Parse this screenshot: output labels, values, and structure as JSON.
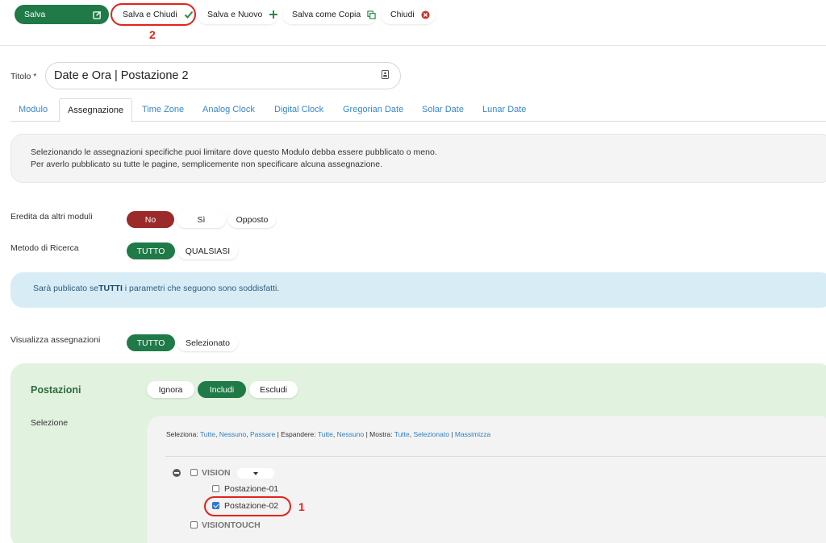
{
  "toolbar": {
    "save_label": "Salva",
    "save_close_label": "Salva e Chiudi",
    "save_new_label": "Salva e Nuovo",
    "save_copy_label": "Salva come Copia",
    "close_label": "Chiudi"
  },
  "annotations": {
    "one": "1",
    "two": "2"
  },
  "title_field": {
    "label": "Titolo *",
    "value": "Date e Ora | Postazione 2"
  },
  "tabs": [
    "Modulo",
    "Assegnazione",
    "Time Zone",
    "Analog Clock",
    "Digital Clock",
    "Gregorian Date",
    "Solar Date",
    "Lunar Date"
  ],
  "active_tab": "Assegnazione",
  "info": {
    "line1": "Selezionando le assegnazioni specifiche puoi limitare dove questo Modulo debba essere pubblicato o meno.",
    "line2": "Per averlo pubblicato su tutte le pagine, semplicemente non specificare alcuna assegnazione."
  },
  "inherit": {
    "label": "Eredita da altri moduli",
    "options": [
      "No",
      "Sì",
      "Opposto"
    ],
    "selected": "No"
  },
  "method": {
    "label": "Metodo di Ricerca",
    "options": [
      "TUTTO",
      "QUALSIASI"
    ],
    "selected": "TUTTO"
  },
  "notice": {
    "prefix": "Sarà publicato se",
    "strong": "TUTTI",
    "suffix": " i parametri che seguono sono soddisfatti."
  },
  "show_assign": {
    "label": "Visualizza assegnazioni",
    "options": [
      "TUTTO",
      "Selezionato"
    ],
    "selected": "TUTTO"
  },
  "postazioni": {
    "title": "Postazioni",
    "options": [
      "Ignora",
      "Includi",
      "Escludi"
    ],
    "selected": "Includi",
    "selection_label": "Selezione",
    "links": {
      "select_label": "Seleziona:",
      "select_all": "Tutte",
      "select_none": "Nessuno",
      "select_pass": "Passare",
      "expand_label": "Espandere:",
      "expand_all": "Tutte",
      "expand_none": "Nessuno",
      "show_label": "Mostra:",
      "show_all": "Tutte",
      "show_selected": "Selezionato",
      "maximize": "Massimizza"
    },
    "tree": {
      "group1": "VISION",
      "item1": "Postazione-01",
      "item2": "Postazione-02",
      "group2": "VISIONTOUCH"
    }
  },
  "colors": {
    "green": "#1f7a48",
    "red": "#9b2a2a",
    "annotation": "#e3231c",
    "link": "#2d7fc0"
  }
}
